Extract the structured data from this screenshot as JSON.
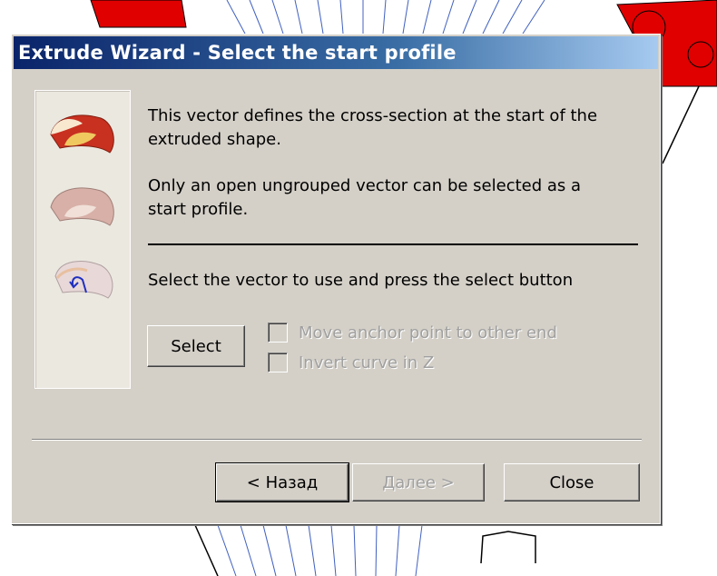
{
  "window": {
    "title": "Extrude Wizard - Select the start profile"
  },
  "instructions": {
    "line1": "This vector defines the cross-section at the start of the",
    "line2": "extruded shape.",
    "line3": "Only an open ungrouped vector can be selected as a",
    "line4": "start profile.",
    "prompt": "Select the vector to use and press the select button"
  },
  "controls": {
    "select_label": "Select",
    "move_anchor_label": "Move anchor point to other end",
    "invert_curve_label": "Invert curve in Z",
    "move_anchor_checked": false,
    "invert_curve_checked": false
  },
  "footer": {
    "back_label": "< Назад",
    "next_label": "Далее >",
    "close_label": "Close"
  },
  "colors": {
    "title_gradient_start": "#0a246a",
    "dialog_face": "#d4d0c8",
    "background_object": "#e00000"
  },
  "side_icons": [
    "extrude-profile-red-icon",
    "extrude-profile-pale-icon",
    "extrude-profile-arrow-icon"
  ]
}
